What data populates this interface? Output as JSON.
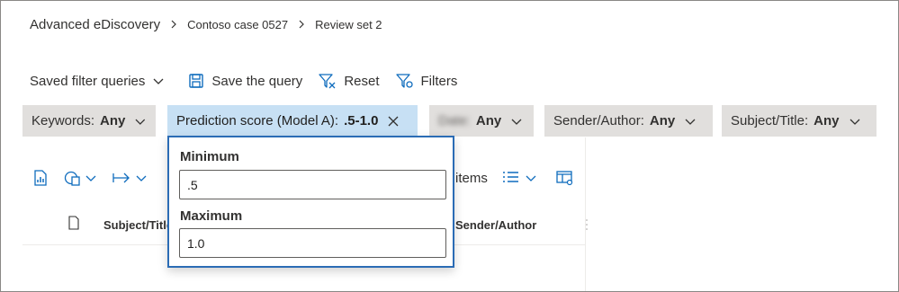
{
  "breadcrumb": {
    "root": "Advanced eDiscovery",
    "items": [
      "Contoso case 0527",
      "Review set 2"
    ]
  },
  "toolbar": {
    "saved_queries_label": "Saved filter queries",
    "save_query_label": "Save the query",
    "reset_label": "Reset",
    "filters_label": "Filters"
  },
  "filters": {
    "keywords": {
      "label": "Keywords:",
      "value": "Any"
    },
    "prediction": {
      "label": "Prediction score (Model A):",
      "value": ".5-1.0"
    },
    "date": {
      "label": "Date:",
      "value": "Any"
    },
    "sender": {
      "label": "Sender/Author:",
      "value": "Any"
    },
    "subject": {
      "label": "Subject/Title:",
      "value": "Any"
    }
  },
  "popup": {
    "minimum_label": "Minimum",
    "minimum_value": ".5",
    "maximum_label": "Maximum",
    "maximum_value": "1.0"
  },
  "grid": {
    "items_label": "items",
    "columns": {
      "subject": "Subject/Title",
      "sender": "Sender/Author"
    }
  },
  "colors": {
    "accent": "#2b6cb5",
    "active_pill": "#c7e0f4",
    "pill": "#e1dfdd",
    "icon_blue": "#0f6cbd"
  },
  "icons": {
    "save": "save-icon",
    "reset": "clear-filter-icon",
    "filters": "filter-settings-icon",
    "report": "report-icon",
    "tag": "tag-document-icon",
    "export": "export-arrow-icon",
    "columns": "list-options-icon",
    "settings": "column-settings-icon"
  }
}
